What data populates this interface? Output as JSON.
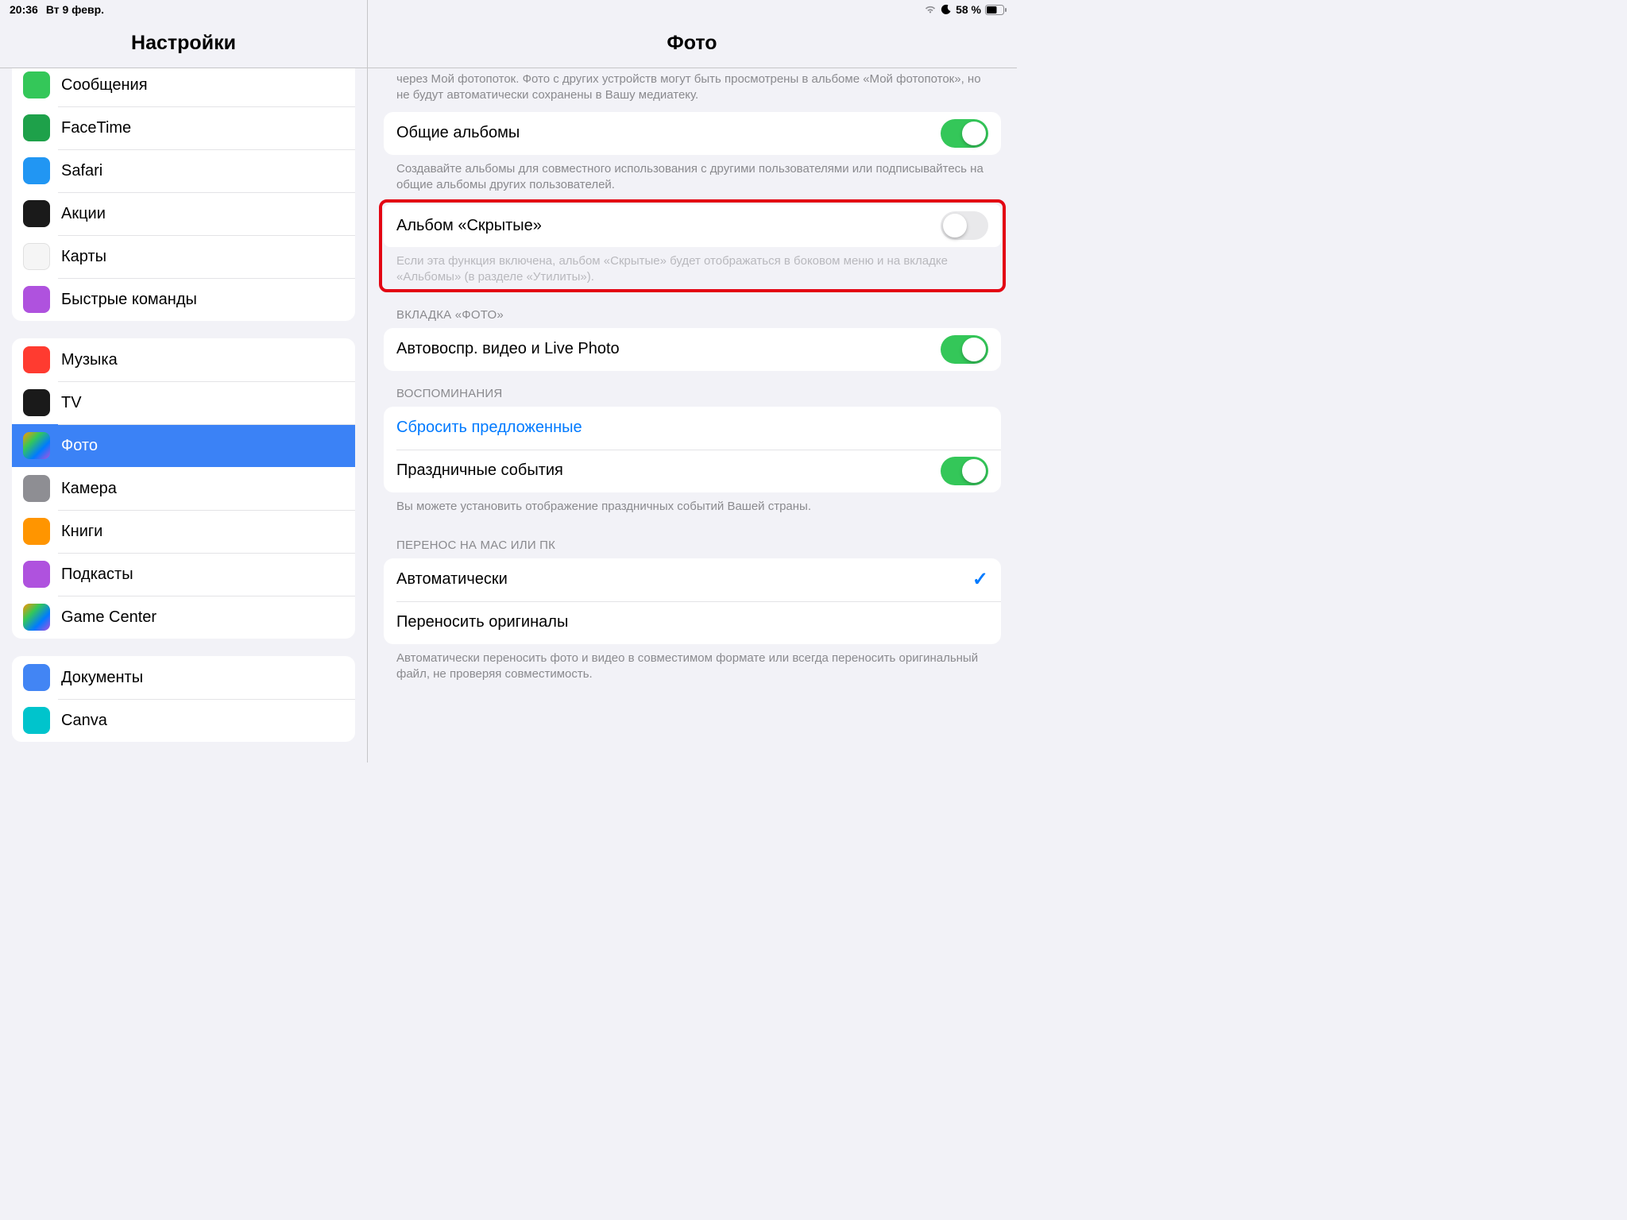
{
  "status": {
    "time": "20:36",
    "date": "Вт 9 февр.",
    "battery": "58 %"
  },
  "sidebar": {
    "title": "Настройки",
    "groups": [
      {
        "id": "apps1",
        "first": true,
        "items": [
          {
            "id": "messages",
            "label": "Сообщения",
            "iconClass": "ic-green"
          },
          {
            "id": "facetime",
            "label": "FaceTime",
            "iconClass": "ic-darkgreen"
          },
          {
            "id": "safari",
            "label": "Safari",
            "iconClass": "ic-blue"
          },
          {
            "id": "stocks",
            "label": "Акции",
            "iconClass": "ic-black"
          },
          {
            "id": "maps",
            "label": "Карты",
            "iconClass": "ic-white"
          },
          {
            "id": "shortcuts",
            "label": "Быстрые команды",
            "iconClass": "ic-purple"
          }
        ]
      },
      {
        "id": "apps2",
        "items": [
          {
            "id": "music",
            "label": "Музыка",
            "iconClass": "ic-red"
          },
          {
            "id": "tv",
            "label": "TV",
            "iconClass": "ic-black"
          },
          {
            "id": "photos",
            "label": "Фото",
            "iconClass": "ic-multi",
            "selected": true
          },
          {
            "id": "camera",
            "label": "Камера",
            "iconClass": "ic-grey"
          },
          {
            "id": "books",
            "label": "Книги",
            "iconClass": "ic-orange"
          },
          {
            "id": "podcasts",
            "label": "Подкасты",
            "iconClass": "ic-purple"
          },
          {
            "id": "gamecenter",
            "label": "Game Center",
            "iconClass": "ic-multi"
          }
        ]
      },
      {
        "id": "apps3",
        "items": [
          {
            "id": "docs",
            "label": "Документы",
            "iconClass": "ic-blue2"
          },
          {
            "id": "canva",
            "label": "Canva",
            "iconClass": "ic-teal"
          }
        ]
      }
    ]
  },
  "detail": {
    "title": "Фото",
    "intro_footer": "через Мой фотопоток. Фото с других устройств могут быть просмотрены в альбоме «Мой фотопоток», но не будут автоматически сохранены в Вашу медиатеку.",
    "shared_albums": {
      "label": "Общие альбомы",
      "on": true,
      "footer": "Создавайте альбомы для совместного использования с другими пользователями или подписывайтесь на общие альбомы других пользователей."
    },
    "hidden_album": {
      "label": "Альбом «Скрытые»",
      "on": false,
      "footer": "Если эта функция включена, альбом «Скрытые» будет отображаться в боковом меню и на вкладке «Альбомы» (в разделе «Утилиты»)."
    },
    "photo_tab": {
      "header": "ВКЛАДКА «ФОТО»",
      "autoplay": {
        "label": "Автовоспр. видео и Live Photo",
        "on": true
      }
    },
    "memories": {
      "header": "ВОСПОМИНАНИЯ",
      "reset": "Сбросить предложенные",
      "holidays": {
        "label": "Праздничные события",
        "on": true
      },
      "footer": "Вы можете установить отображение праздничных событий Вашей страны."
    },
    "transfer": {
      "header": "ПЕРЕНОС НА MAC ИЛИ ПК",
      "auto": "Автоматически",
      "originals": "Переносить оригиналы",
      "selected": "auto",
      "footer": "Автоматически переносить фото и видео в совместимом формате или всегда переносить оригинальный файл, не проверяя совместимость."
    }
  }
}
